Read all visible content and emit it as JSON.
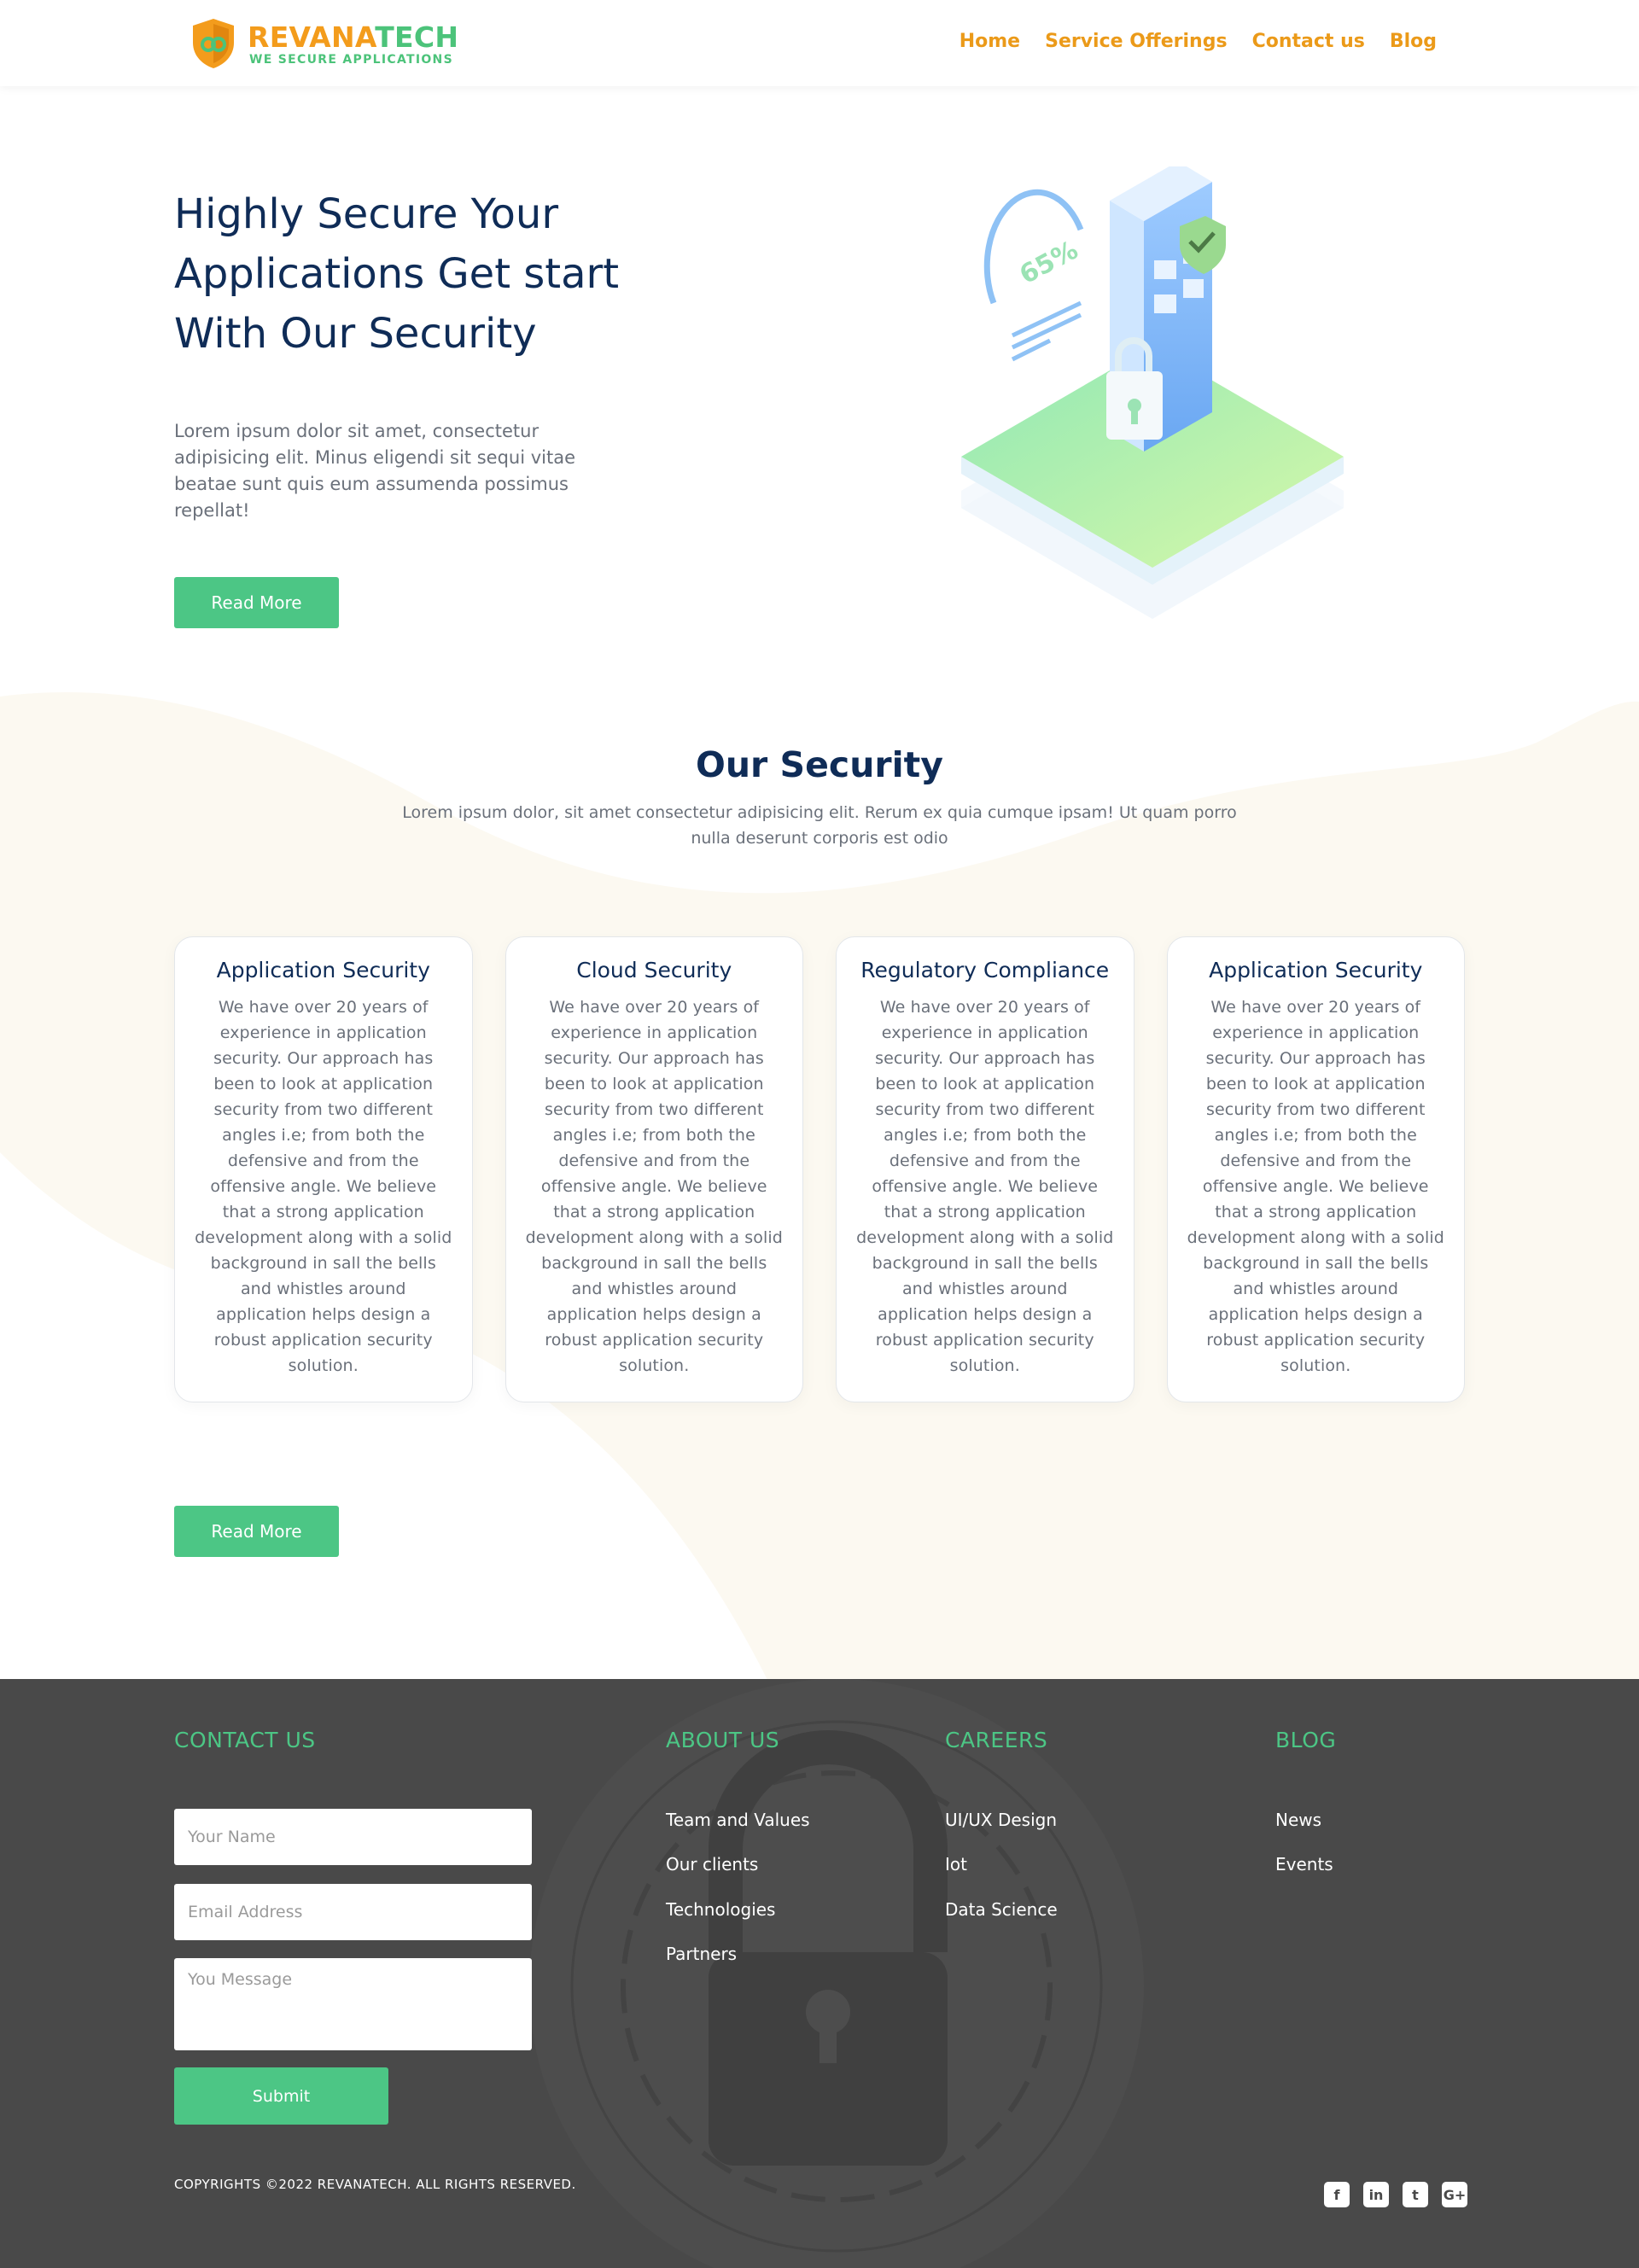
{
  "header": {
    "logo_name_part1": "REVANA",
    "logo_name_part2": "TECH",
    "logo_tagline": "WE SECURE APPLICATIONS",
    "nav": [
      "Home",
      "Service Offerings",
      "Contact us",
      "Blog"
    ]
  },
  "hero": {
    "title": "Highly Secure Your Applications Get start With Our Security",
    "text": "Lorem ipsum dolor sit amet, consectetur adipisicing elit. Minus eligendi sit sequi vitae beatae sunt quis eum assumenda possimus repellat!",
    "button": "Read More",
    "illustration_percent": "65%"
  },
  "security": {
    "title": "Our Security",
    "subtitle": "Lorem ipsum dolor, sit amet consectetur adipisicing elit. Rerum ex quia cumque ipsam! Ut quam porro nulla deserunt corporis est odio",
    "cards": [
      {
        "title": "Application Security",
        "text": "We have over 20 years of experience in application security. Our approach has been to look at application security from two different angles i.e; from both the defensive and from the offensive angle. We believe that a strong application development along with a solid background in sall the bells and whistles around application helps design a robust application security solution."
      },
      {
        "title": "Cloud Security",
        "text": "We have over 20 years of experience in application security. Our approach has been to look at application security from two different angles i.e; from both the defensive and from the offensive angle. We believe that a strong application development along with a solid background in sall the bells and whistles around application helps design a robust application security solution."
      },
      {
        "title": "Regulatory Compliance",
        "text": "We have over 20 years of experience in application security. Our approach has been to look at application security from two different angles i.e; from both the defensive and from the offensive angle. We believe that a strong application development along with a solid background in sall the bells and whistles around application helps design a robust application security solution."
      },
      {
        "title": "Application Security",
        "text": "We have over 20 years of experience in application security. Our approach has been to look at application security from two different angles i.e; from both the defensive and from the offensive angle. We believe that a strong application development along with a solid background in sall the bells and whistles around application helps design a robust application security solution."
      }
    ],
    "button": "Read More"
  },
  "footer": {
    "contact": {
      "heading": "CONTACT US",
      "name_placeholder": "Your Name",
      "email_placeholder": "Email Address",
      "message_placeholder": "You Message",
      "submit": "Submit"
    },
    "about": {
      "heading": "ABOUT US",
      "links": [
        "Team and Values",
        "Our clients",
        "Technologies",
        "Partners"
      ]
    },
    "careers": {
      "heading": "CAREERS",
      "links": [
        "UI/UX Design",
        "Iot",
        "Data Science"
      ]
    },
    "blog": {
      "heading": "BLOG",
      "links": [
        "News",
        "Events"
      ]
    },
    "copyright": "COPYRIGHTS ©2022 REVANATECH. ALL RIGHTS RESERVED.",
    "social": [
      {
        "icon": "facebook-icon",
        "glyph": "f"
      },
      {
        "icon": "linkedin-icon",
        "glyph": "in"
      },
      {
        "icon": "twitter-icon",
        "glyph": "t"
      },
      {
        "icon": "google-plus-icon",
        "glyph": "G+"
      }
    ]
  },
  "colors": {
    "accent_orange": "#eb9a19",
    "accent_green": "#4cc685",
    "navy": "#0f2c57",
    "footer_bg": "#494949"
  }
}
